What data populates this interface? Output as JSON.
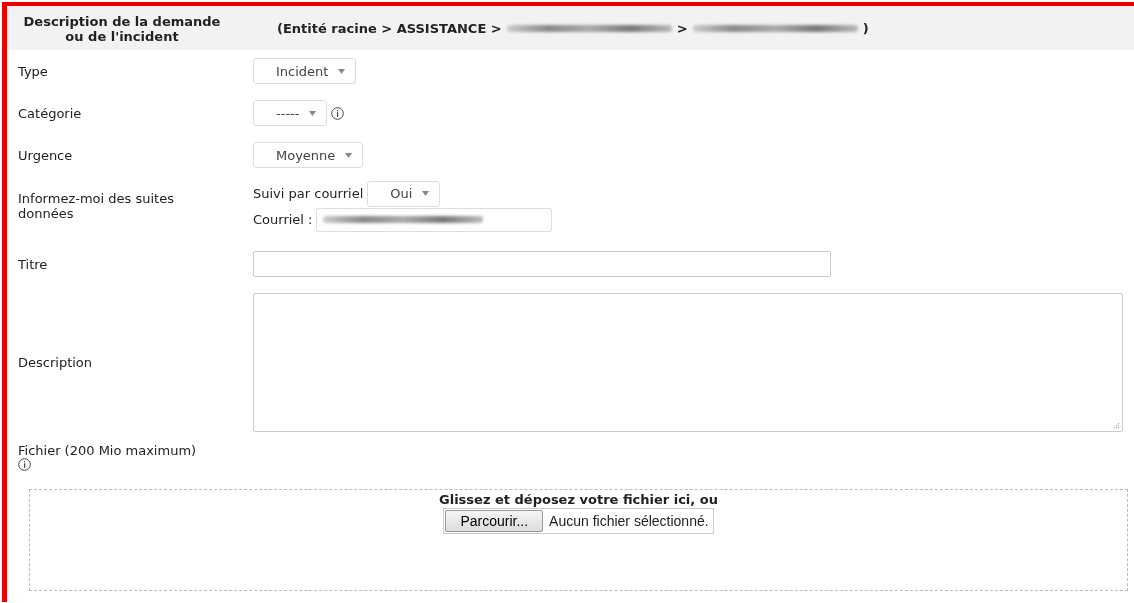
{
  "header": {
    "title": "Description de la demande ou de l'incident",
    "breadcrumb_start": "(Entité racine > ASSISTANCE >",
    "breadcrumb_separator": ">",
    "breadcrumb_end": ")"
  },
  "fields": [
    {
      "kind": "select",
      "label": "Type",
      "value": "Incident",
      "info": false
    },
    {
      "kind": "select",
      "label": "Catégorie",
      "value": "-----",
      "info": true
    },
    {
      "kind": "select",
      "label": "Urgence",
      "value": "Moyenne",
      "info": false
    },
    {
      "kind": "followup",
      "label": "Informez-moi des suites données",
      "follow_label": "Suivi par courriel",
      "follow_value": "Oui",
      "email_label": "Courriel :"
    },
    {
      "kind": "text",
      "label": "Titre"
    },
    {
      "kind": "textarea",
      "label": "Description"
    }
  ],
  "file": {
    "label": "Fichier (200 Mio maximum)",
    "drop_text": "Glissez et déposez votre fichier ici, ou",
    "browse_button": "Parcourir...",
    "no_file_text": "Aucun fichier sélectionné."
  }
}
